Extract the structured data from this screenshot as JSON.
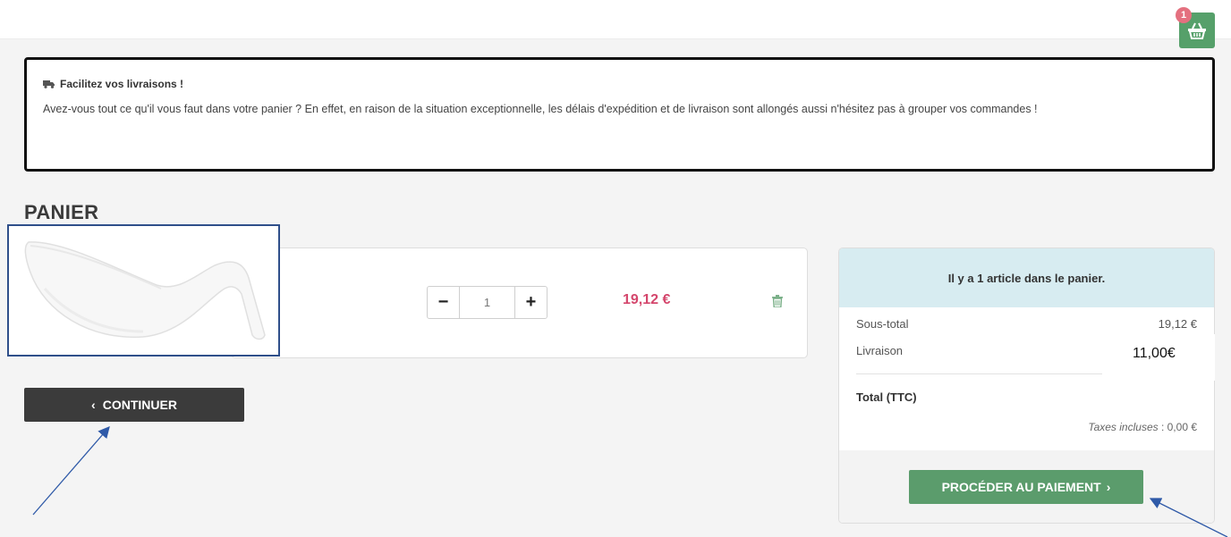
{
  "header": {
    "cart_count": "1",
    "cart_icon": "shopping-basket-icon"
  },
  "notice": {
    "icon": "truck-icon",
    "title": "Facilitez vos livraisons !",
    "text": "Avez-vous tout ce qu'il vous faut dans votre panier ? En effet, en raison de la situation exceptionnelle, les délais d'expédition et de livraison sont allongés aussi n'hésitez pas à grouper vos commandes !"
  },
  "page_title": "PANIER",
  "cart_item": {
    "image": "white-ceramic-bowl",
    "minus_label": "−",
    "quantity": "1",
    "plus_label": "+",
    "price": "19,12 €",
    "delete_icon": "trash-icon"
  },
  "continue_button": {
    "chevron": "‹",
    "label": "CONTINUER"
  },
  "summary": {
    "header": "Il y a 1 article dans le panier.",
    "subtotal_label": "Sous-total",
    "subtotal_value": "19,12 €",
    "shipping_label": "Livraison",
    "shipping_value": "11,00€",
    "total_label": "Total (TTC)",
    "taxes_label": "Taxes incluses",
    "taxes_value": ": 0,00 €",
    "checkout_label": "PROCÉDER AU PAIEMENT",
    "checkout_chevron": "›"
  },
  "colors": {
    "brand_green": "#5b9c6c",
    "price_pink": "#d4466c",
    "summary_header_bg": "#d7ecf1",
    "annotation_blue": "#2f5aa8"
  }
}
